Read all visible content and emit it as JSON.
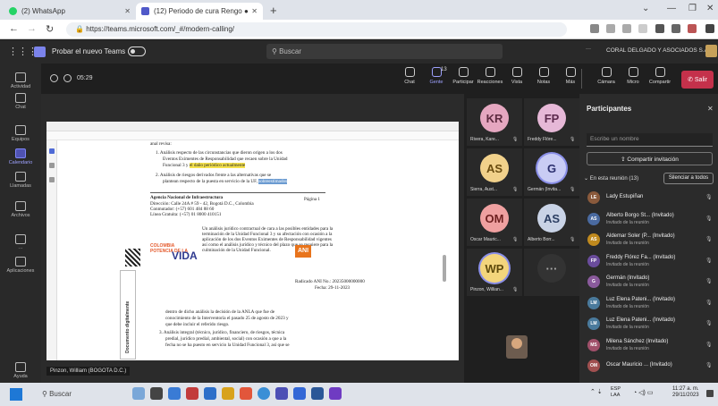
{
  "browser": {
    "tabs": [
      {
        "title": "(2) WhatsApp",
        "icon": "whatsapp-icon",
        "color": "#25d366"
      },
      {
        "title": "(12) Periodo de cura Rengo ● ",
        "icon": "teams-icon",
        "color": "#5059c9"
      }
    ],
    "new_tab": "+",
    "url": "https://teams.microsoft.com/_#/modern-calling/"
  },
  "teams_bar": {
    "try_new": "Probar el nuevo Teams",
    "search_placeholder": "Buscar",
    "more": "···",
    "org": "CORAL DELGADO Y ASOCIADOS S.A.S"
  },
  "rail": [
    {
      "label": "Actividad",
      "icon": "bell-icon"
    },
    {
      "label": "Chat",
      "icon": "chat-icon"
    },
    {
      "label": "Equipos",
      "icon": "teams-icon"
    },
    {
      "label": "Calendario",
      "icon": "calendar-icon",
      "active": true
    },
    {
      "label": "Llamadas",
      "icon": "phone-icon"
    },
    {
      "label": "Archivos",
      "icon": "files-icon"
    },
    {
      "label": "···",
      "icon": "more-icon"
    },
    {
      "label": "Aplicaciones",
      "icon": "apps-icon"
    },
    {
      "label": "Ayuda",
      "icon": "help-icon"
    }
  ],
  "meeting": {
    "timer": "05:29",
    "controls": [
      {
        "label": "Chat",
        "icon": "chat-icon"
      },
      {
        "label": "Gente",
        "icon": "people-icon",
        "selected": true,
        "badge": "13"
      },
      {
        "label": "Participar",
        "icon": "raise-hand-icon"
      },
      {
        "label": "Reacciones",
        "icon": "emoji-icon"
      },
      {
        "label": "Vista",
        "icon": "view-icon"
      },
      {
        "label": "Notas",
        "icon": "notes-icon"
      },
      {
        "label": "Más",
        "icon": "more-icon"
      },
      {
        "label": "Cámara",
        "icon": "camera-icon"
      },
      {
        "label": "Micro",
        "icon": "mic-icon"
      },
      {
        "label": "Compartir",
        "icon": "share-icon"
      }
    ],
    "leave": "Salir",
    "presenter": "Pinzon, William (BOGOTA D.C.)"
  },
  "document": {
    "intro": "anal revisa:",
    "item1a": "1. Análisis respecto de las circunstancias que dieron origen a los dos",
    "item1b": "Eventos Eximentes de Responsabilidad que recaen sobre la Unidad",
    "item1c_pre": "Funcional 3 y",
    "item1c_hl": "el daño periódico actualmente",
    "item2a": "2. Análisis de riesgos derivados frente a las alternativas que se",
    "item2b_pre": "plantean respecto de la puesta en servicio de la UF,",
    "item2b_hl": "sobreestimados",
    "agency": "Agencia Nacional de Infraestructura",
    "addr1": "Dirección: Calle 24A # 59 - 42, Bogotá D.C., Colombia",
    "addr2": "Conmutador: (+57) 601 484 88 60",
    "addr3": "Línea Gratuita: (+57) 01 8000 410151",
    "page": "Página 1",
    "box1": "Un análisis jurídico contractual de cara a las posibles entidades para la",
    "box2": "terminación de la Unidad Funcional 3 y su afectación con ocasión a la",
    "box3": "aplicación de los dos Eventos Eximentes de Responsabilidad vigentes",
    "box4": "así como el análisis jurídico y técnico del plazo que se requiere para la",
    "box5": "culminación de la Unidad Funcional.",
    "colombia": "COLOMBIA\nPOTENCIA DE LA",
    "vida": "VIDA",
    "ani": "ANI",
    "vertical": "Documento digitalmente",
    "rad1": "Radicado ANI No.: 20235000000000",
    "rad2": "Fecha: 29-11-2023",
    "p1": "dentro de dicho análisis la decisión de la ANLA que fue de",
    "p2": "conocimiento de la Interventoría el pasado 25 de agosto de 2023 y",
    "p3": "que debe incluir el referido riesgo.",
    "p4": "3. Análisis integral (técnico, jurídico, financiero, de riesgos, técnica",
    "p5": "predial, jurídico predial, ambiental, social) con ocasión a que a la",
    "p6": "fecha no se ha puesto en servicio la Unidad Funcional 3, así que se"
  },
  "tiles": [
    {
      "initials": "KR",
      "name": "Rivera, Kare...",
      "bg": "#e5a7c0",
      "fg": "#5d2b40"
    },
    {
      "initials": "FP",
      "name": "Freddy Flóre...",
      "bg": "#e6b8d7",
      "fg": "#5c2a4d"
    },
    {
      "initials": "AS",
      "name": "Sierra, Aust...",
      "bg": "#f1d18b",
      "fg": "#6a4c10"
    },
    {
      "initials": "G",
      "name": "Germán (Invita...",
      "bg": "#c9ccf4",
      "fg": "#2b2f6e"
    },
    {
      "initials": "OM",
      "name": "Oscar Mauric...",
      "bg": "#efa0a0",
      "fg": "#6e2020"
    },
    {
      "initials": "AS",
      "name": "Alberto Borr...",
      "bg": "#c9d3e6",
      "fg": "#2b3e62"
    },
    {
      "initials": "WP",
      "name": "Pinzon, Willian...",
      "bg": "#f3d57c",
      "fg": "#5e4a0c"
    },
    {
      "initials": "···",
      "name": "",
      "bg": "#333333",
      "fg": "#aaaaaa"
    }
  ],
  "participants": {
    "title": "Participantes",
    "search_placeholder": "Escribe un nombre",
    "share_invite": "Compartir invitación",
    "in_meeting": "En esta reunión (13)",
    "mute_all": "Silenciar a todos",
    "list": [
      {
        "name": "Lady Estupiñan",
        "role": "",
        "initials": "LE",
        "color": "#8a5a3c"
      },
      {
        "name": "Alberto Borgo St... (Invitado)",
        "role": "Invitado de la reunión",
        "initials": "AS",
        "color": "#4a6aa0"
      },
      {
        "name": "Aldemar Soler (P... (Invitado)",
        "role": "Invitado de la reunión",
        "initials": "AS",
        "color": "#c08a1e"
      },
      {
        "name": "Freddy Flórez Fa... (Invitado)",
        "role": "Invitado de la reunión",
        "initials": "FP",
        "color": "#6a4c9c"
      },
      {
        "name": "Germán (Invitado)",
        "role": "Invitado de la reunión",
        "initials": "G",
        "color": "#8a5a9c"
      },
      {
        "name": "Luz Elena Pateni... (Invitado)",
        "role": "Invitado de la reunión",
        "initials": "LM",
        "color": "#4a7a9c"
      },
      {
        "name": "Luz Elena Pateni... (Invitado)",
        "role": "Invitado de la reunión",
        "initials": "LM",
        "color": "#4a7a9c"
      },
      {
        "name": "Milena Sánchez (Invitado)",
        "role": "Invitado de la reunión",
        "initials": "MS",
        "color": "#a0506a"
      },
      {
        "name": "Oscar Mauricio ... (Invitado)",
        "role": "",
        "initials": "OM",
        "color": "#a05050"
      }
    ]
  },
  "taskbar": {
    "search": "Buscar",
    "lang1": "ESP",
    "lang2": "LAA",
    "time": "11:27 a. m.",
    "date": "29/11/2023"
  }
}
